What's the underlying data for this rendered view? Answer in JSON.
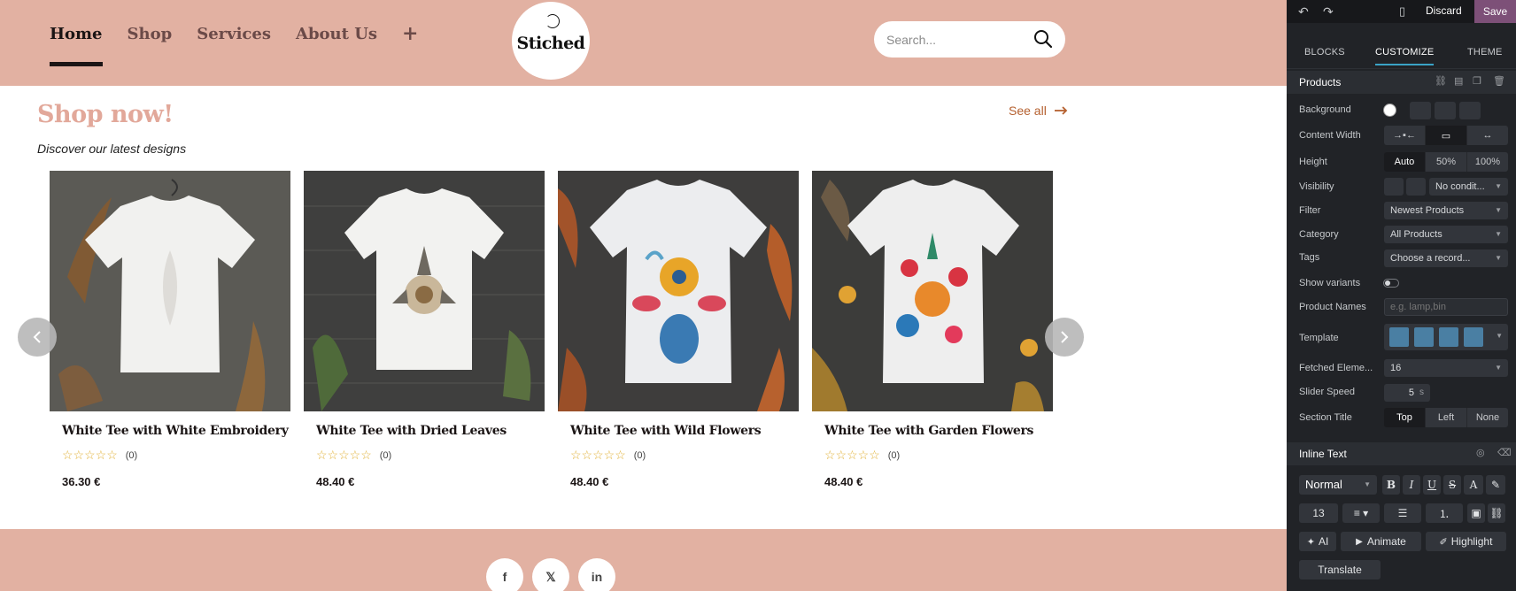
{
  "site": {
    "nav": {
      "home": "Home",
      "shop": "Shop",
      "services": "Services",
      "about": "About Us",
      "plus": "+"
    },
    "logo_text": "Stiched",
    "search": {
      "placeholder": "Search...",
      "icon": "search-icon"
    },
    "section": {
      "title": "Shop now!",
      "subtitle": "Discover our latest designs",
      "see_all": "See all"
    },
    "products": [
      {
        "name": "White Tee with White Embroidery",
        "rating": "☆☆☆☆☆",
        "reviews": "(0)",
        "price": "36.30 €"
      },
      {
        "name": "White Tee with Dried Leaves",
        "rating": "☆☆☆☆☆",
        "reviews": "(0)",
        "price": "48.40 €"
      },
      {
        "name": "White Tee with Wild Flowers",
        "rating": "☆☆☆☆☆",
        "reviews": "(0)",
        "price": "48.40 €"
      },
      {
        "name": "White Tee with Garden Flowers",
        "rating": "☆☆☆☆☆",
        "reviews": "(0)",
        "price": "48.40 €"
      }
    ],
    "social": {
      "facebook": "f",
      "x": "𝕏",
      "linkedin": "in"
    },
    "colors": {
      "header": "#e2b1a2",
      "title": "#e2a89a",
      "link": "#b5602f"
    }
  },
  "editor": {
    "topbar": {
      "discard": "Discard",
      "save": "Save"
    },
    "tabs": {
      "blocks": "BLOCKS",
      "customize": "CUSTOMIZE",
      "theme": "THEME"
    },
    "products_section": "Products",
    "labels": {
      "background": "Background",
      "content_width": "Content Width",
      "height": "Height",
      "visibility": "Visibility",
      "filter": "Filter",
      "category": "Category",
      "tags": "Tags",
      "show_variants": "Show variants",
      "product_names": "Product Names",
      "template": "Template",
      "fetched": "Fetched Eleme...",
      "slider_speed": "Slider Speed",
      "section_title": "Section Title"
    },
    "height_options": {
      "auto": "Auto",
      "half": "50%",
      "full": "100%"
    },
    "visibility_value": "No condit...",
    "filter_value": "Newest Products",
    "category_value": "All Products",
    "tags_value": "Choose a record...",
    "product_names_placeholder": "e.g. lamp,bin",
    "fetched_value": "16",
    "slider_speed_value": "5",
    "slider_speed_unit": "s",
    "section_title_options": {
      "top": "Top",
      "left": "Left",
      "none": "None"
    },
    "inline_text": "Inline Text",
    "text_style": "Normal",
    "font_size": "13",
    "buttons": {
      "ai": "AI",
      "animate": "Animate",
      "highlight": "Highlight",
      "translate": "Translate"
    },
    "format": {
      "bold": "B",
      "italic": "I",
      "underline": "U",
      "strike": "S",
      "color": "A"
    },
    "accent": "#7d5078"
  }
}
